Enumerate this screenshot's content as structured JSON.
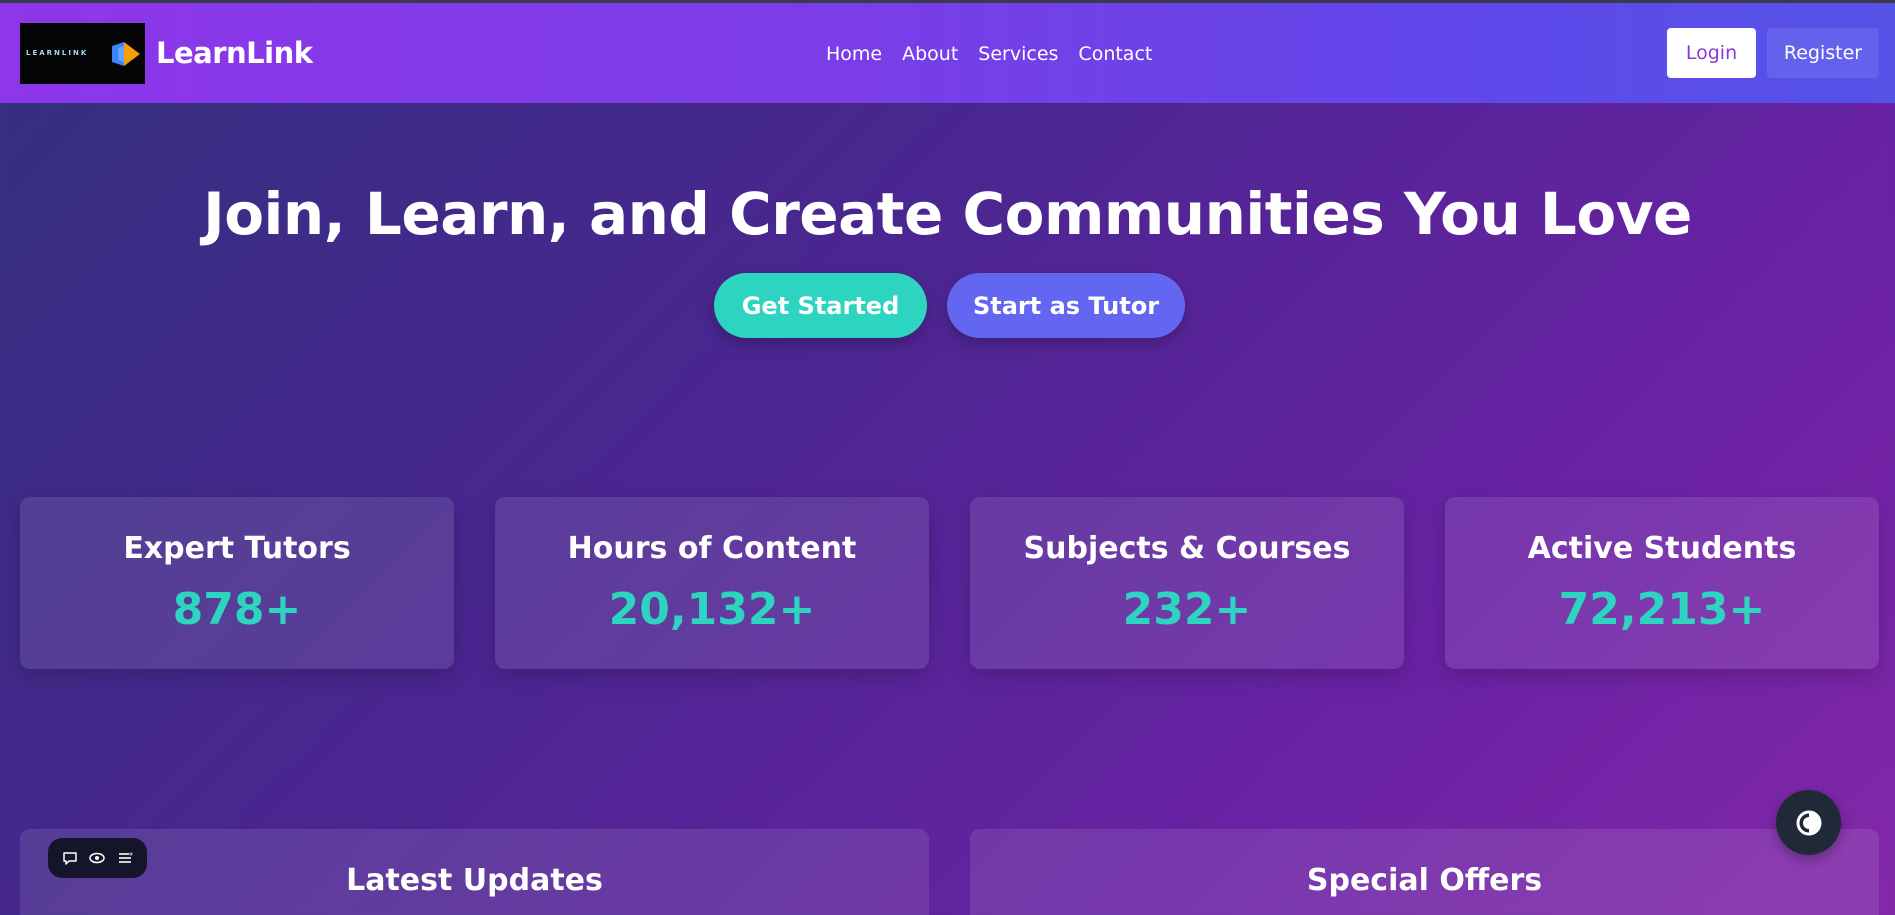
{
  "header": {
    "logo_text": "LEARNLINK",
    "brand": "LearnLink",
    "nav": [
      "Home",
      "About",
      "Services",
      "Contact"
    ],
    "login_label": "Login",
    "register_label": "Register"
  },
  "hero": {
    "title": "Join, Learn, and Create Communities You Love",
    "primary_button": "Get Started",
    "secondary_button": "Start as Tutor"
  },
  "stats": [
    {
      "label": "Expert Tutors",
      "value": "878+"
    },
    {
      "label": "Hours of Content",
      "value": "20,132+"
    },
    {
      "label": "Subjects & Courses",
      "value": "232+"
    },
    {
      "label": "Active Students",
      "value": "72,213+"
    }
  ],
  "panels": [
    {
      "title": "Latest Updates"
    },
    {
      "title": "Special Offers"
    }
  ],
  "toolbar_icons": [
    "comment-icon",
    "eye-icon",
    "menu-icon"
  ],
  "fab_icon": "contrast-icon",
  "colors": {
    "accent": "#2dd4bf",
    "secondary": "#6366f1",
    "header_start": "#8e36e9",
    "header_end": "#5552e6"
  }
}
